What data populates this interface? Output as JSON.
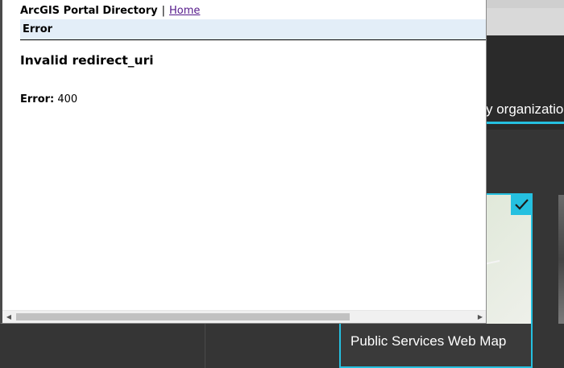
{
  "popup": {
    "portal_title": "ArcGIS Portal Directory",
    "separator": "|",
    "home_link": "Home",
    "section_title": "Error",
    "error_heading": "Invalid redirect_uri",
    "error_code_label": "Error:",
    "error_code_value": "400"
  },
  "background": {
    "org_tab_label": "y organization",
    "map_card_title": "Public Services Web Map",
    "selected_icon": "checkmark-icon"
  },
  "colors": {
    "accent": "#25c0e0",
    "header_bar": "#e3eef8",
    "link_visited": "#551a8b",
    "app_dark": "#2b2b2b"
  }
}
